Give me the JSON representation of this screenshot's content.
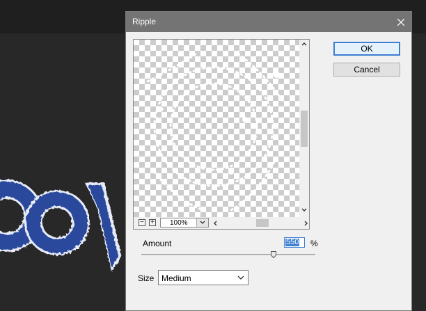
{
  "dialog": {
    "title": "Ripple",
    "ok_label": "OK",
    "cancel_label": "Cancel"
  },
  "preview": {
    "zoom": "100%",
    "zoom_out_symbol": "−",
    "zoom_in_symbol": "+"
  },
  "amount": {
    "label": "Amount",
    "value": "550",
    "unit": "%",
    "level": 0.76
  },
  "size": {
    "label": "Size",
    "selected": "Medium"
  },
  "colors": {
    "accent": "#3d7fd1",
    "titlebar": "#747474",
    "canvas_bg": "#282828",
    "art_blue": "#2a4a9c"
  },
  "icons": [
    "close-icon",
    "chevron-up-icon",
    "chevron-down-icon",
    "chevron-left-icon",
    "chevron-right-icon",
    "zoom-out-icon",
    "zoom-in-icon",
    "slider-thumb-icon"
  ]
}
